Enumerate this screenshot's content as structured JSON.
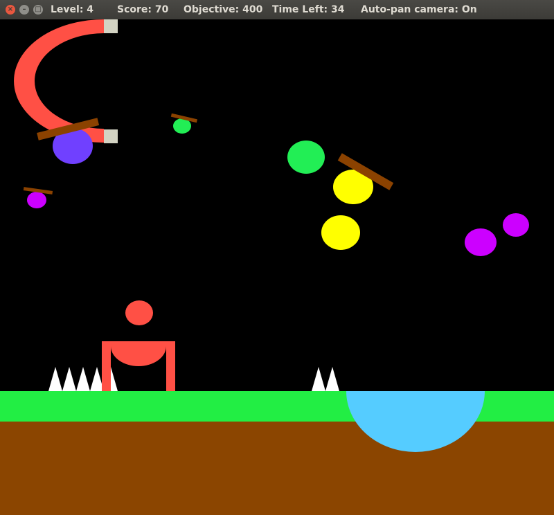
{
  "window": {
    "close_glyph": "×",
    "min_glyph": "–",
    "max_glyph": "□"
  },
  "hud": {
    "level_label": "Level: 4",
    "score_label": "Score: 70",
    "objective_label": "Objective: 400",
    "time_left_label": "Time Left: 34",
    "auto_pan_label": "Auto-pan camera: On"
  },
  "colors": {
    "background": "#000000",
    "magnet": "#ff5045",
    "magnet_tip": "#d3d3c3",
    "plank": "#8b4200",
    "ball_purple": "#7040ff",
    "ball_green": "#22ee55",
    "ball_magenta": "#cc00ff",
    "ball_yellow": "#ffff00",
    "ball_red": "#ff5045",
    "spikes": "#ffffff",
    "grass": "#22ee44",
    "dirt": "#8b4500",
    "water": "#55ccff"
  }
}
